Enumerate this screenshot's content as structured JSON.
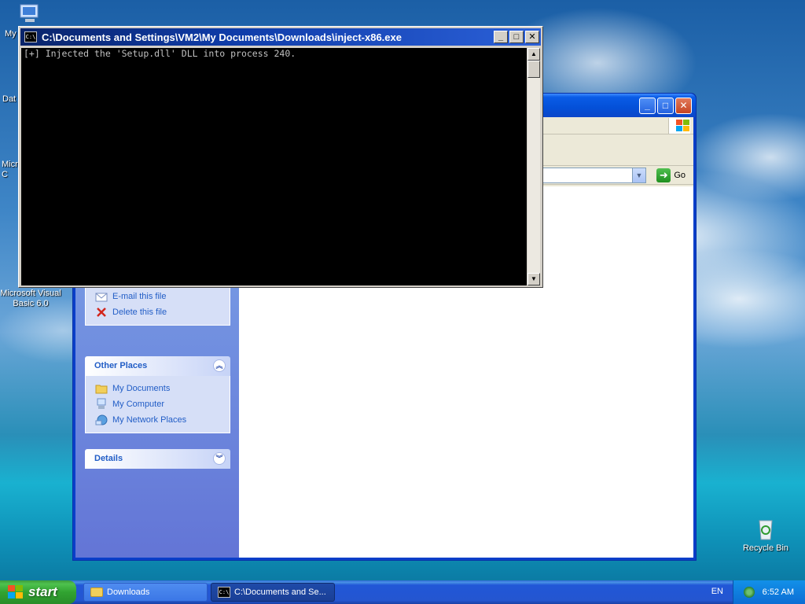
{
  "desktop": {
    "icons": [
      {
        "label": "My"
      },
      {
        "label": "Dat"
      },
      {
        "label": "Micro\nC"
      },
      {
        "label": "Microsoft Visual Basic 6.0"
      },
      {
        "label": "Recycle Bin"
      }
    ]
  },
  "console": {
    "title": "C:\\Documents and Settings\\VM2\\My Documents\\Downloads\\inject-x86.exe",
    "icon_text": "C:\\",
    "output": "[+] Injected the 'Setup.dll' DLL into process 240.",
    "buttons": {
      "minimize": "_",
      "maximize": "□",
      "close": "✕"
    }
  },
  "explorer": {
    "buttons": {
      "minimize": "_",
      "maximize": "□",
      "close": "✕"
    },
    "address": {
      "go_label": "Go",
      "dropdown": "▼",
      "go_arrow": "➜"
    },
    "file_tasks": {
      "items": [
        {
          "label": "E-mail this file",
          "icon": "email-icon"
        },
        {
          "label": "Delete this file",
          "icon": "delete-x-icon"
        }
      ]
    },
    "other_places": {
      "title": "Other Places",
      "collapse": "︽",
      "items": [
        {
          "label": "My Documents",
          "icon": "folder-icon"
        },
        {
          "label": "My Computer",
          "icon": "computer-icon"
        },
        {
          "label": "My Network Places",
          "icon": "network-icon"
        }
      ]
    },
    "details": {
      "title": "Details",
      "expand": "︾"
    }
  },
  "taskbar": {
    "start_label": "start",
    "tasks": [
      {
        "label": "Downloads",
        "active": false
      },
      {
        "label": "C:\\Documents and Se...",
        "active": true
      }
    ],
    "language": "EN",
    "clock": "6:52 AM"
  },
  "colors": {
    "xp_blue": "#0450d8",
    "taskpane_link": "#215dc6",
    "start_green": "#31a331"
  }
}
